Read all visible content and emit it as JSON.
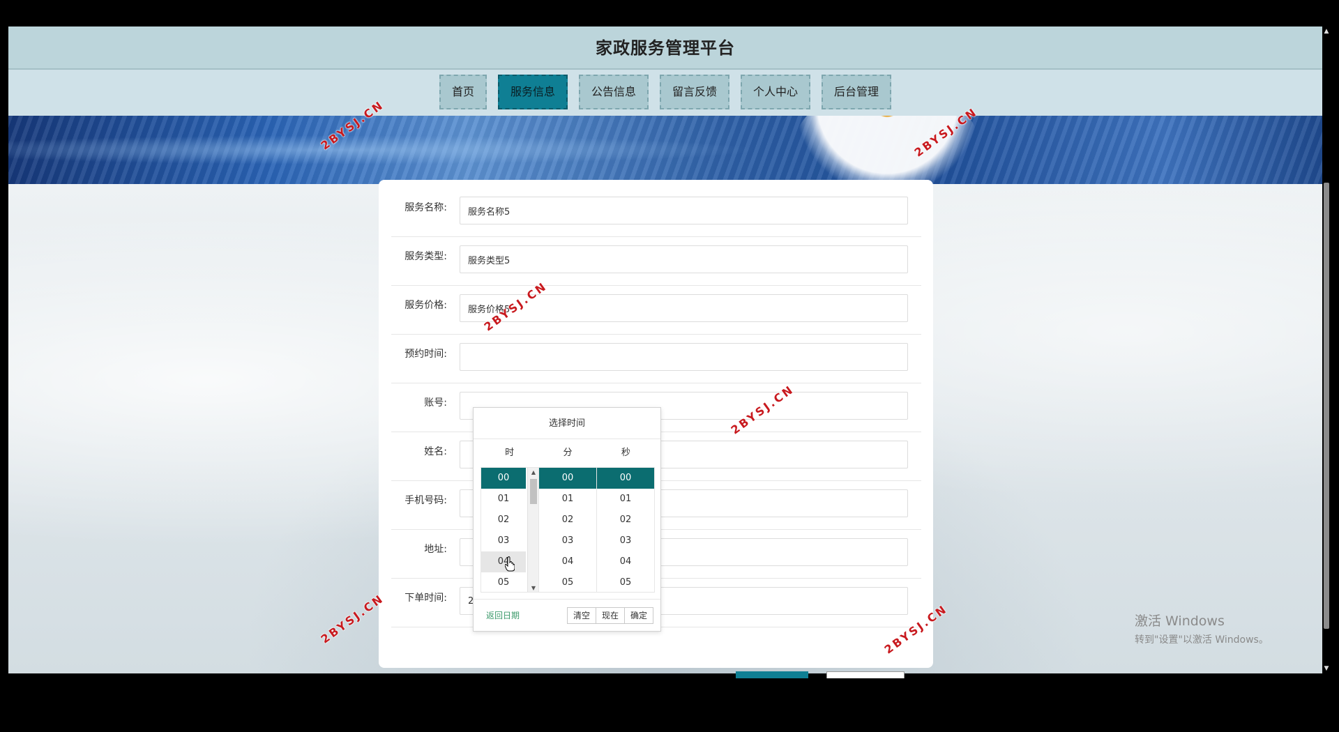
{
  "app": {
    "title": "家政服务管理平台"
  },
  "nav": {
    "items": [
      {
        "label": "首页",
        "active": false
      },
      {
        "label": "服务信息",
        "active": true
      },
      {
        "label": "公告信息",
        "active": false
      },
      {
        "label": "留言反馈",
        "active": false
      },
      {
        "label": "个人中心",
        "active": false
      },
      {
        "label": "后台管理",
        "active": false
      }
    ]
  },
  "form": {
    "fields": [
      {
        "label": "服务名称:",
        "value": "服务名称5"
      },
      {
        "label": "服务类型:",
        "value": "服务类型5"
      },
      {
        "label": "服务价格:",
        "value": "服务价格5"
      },
      {
        "label": "预约时间:",
        "value": ""
      },
      {
        "label": "账号:",
        "value": ""
      },
      {
        "label": "姓名:",
        "value": ""
      },
      {
        "label": "手机号码:",
        "value": ""
      },
      {
        "label": "地址:",
        "value": ""
      },
      {
        "label": "下单时间:",
        "value": "2022-04-14 22:50:22"
      }
    ]
  },
  "time_picker": {
    "title": "选择时间",
    "col_hour": "时",
    "col_minute": "分",
    "col_second": "秒",
    "hours": [
      "00",
      "01",
      "02",
      "03",
      "04",
      "05"
    ],
    "minutes": [
      "00",
      "01",
      "02",
      "03",
      "04",
      "05"
    ],
    "seconds": [
      "00",
      "01",
      "02",
      "03",
      "04",
      "05"
    ],
    "selected": {
      "hour": "00",
      "minute": "00",
      "second": "00"
    },
    "hovered_hour": "04",
    "back_label": "返回日期",
    "clear_label": "清空",
    "now_label": "现在",
    "confirm_label": "确定"
  },
  "watermark": "2BYSJ.CN",
  "windows_activation": {
    "line1": "激活 Windows",
    "line2": "转到\"设置\"以激活 Windows。"
  },
  "colors": {
    "accent": "#0f7f94",
    "selected": "#0b6d70",
    "header": "#bcd5db",
    "nav": "#cfe1e8",
    "link_green": "#3c9a6b",
    "watermark_red": "#c8191e"
  }
}
